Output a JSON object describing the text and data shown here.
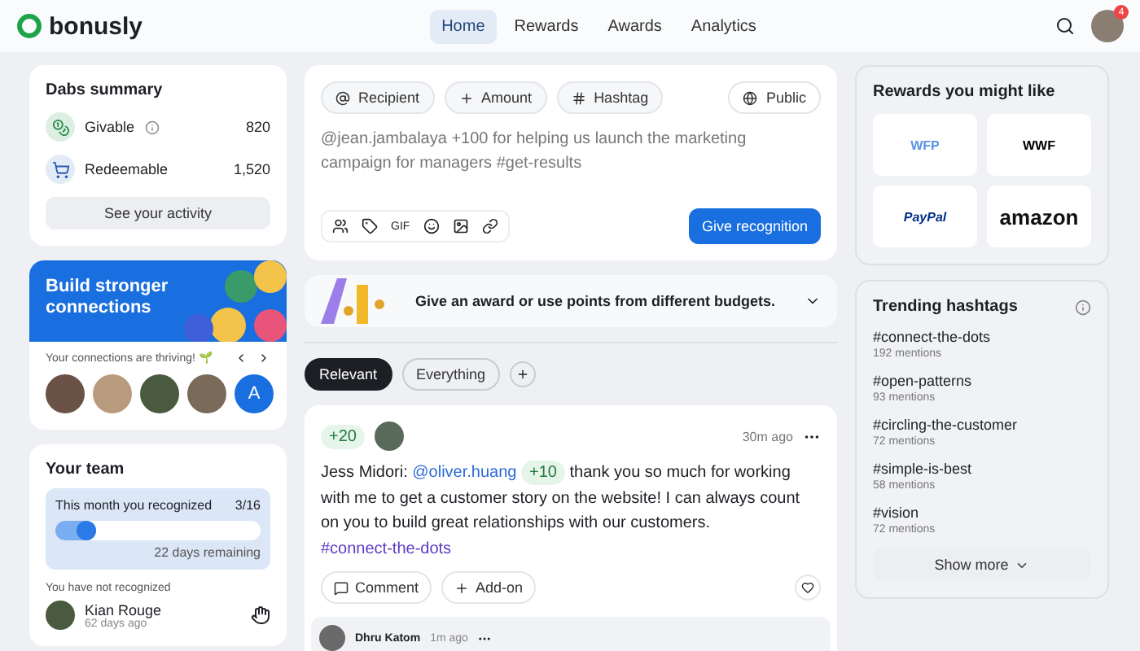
{
  "header": {
    "logo": "bonusly",
    "nav": [
      {
        "label": "Home",
        "selected": true
      },
      {
        "label": "Rewards",
        "selected": false
      },
      {
        "label": "Awards",
        "selected": false
      },
      {
        "label": "Analytics",
        "selected": false
      }
    ],
    "notifications": "4"
  },
  "dabs": {
    "title": "Dabs summary",
    "rows": [
      {
        "kind": "givable",
        "label": "Givable",
        "value": "820"
      },
      {
        "kind": "redeemable",
        "label": "Redeemable",
        "value": "1,520"
      }
    ],
    "button": "See your activity"
  },
  "connections": {
    "title": "Build stronger connections",
    "note": "Your connections are thriving! 🌱",
    "more_initial": "A"
  },
  "team": {
    "title": "Your team",
    "progress_label": "This month you recognized",
    "progress_value": "3/16",
    "level": 0.2,
    "remaining": "22 days remaining",
    "not_recognized": "You have not recognized",
    "person": {
      "name": "Kian Rouge",
      "time": "62 days ago"
    }
  },
  "composer": {
    "chips": [
      {
        "kind": "recipient",
        "label": "Recipient"
      },
      {
        "kind": "amount",
        "label": "Amount"
      },
      {
        "kind": "hashtag",
        "label": "Hashtag"
      }
    ],
    "visibility": "Public",
    "placeholder": "@jean.jambalaya +100 for helping us launch the marketing campaign for managers #get-results",
    "gif": "GIF",
    "submit": "Give recognition"
  },
  "banner": {
    "text": "Give an award or use points from different budgets."
  },
  "filters": [
    {
      "label": "Relevant",
      "selected": true
    },
    {
      "label": "Everything",
      "selected": false
    }
  ],
  "post": {
    "amount": "+20",
    "time": "30m ago",
    "author": "Jess Midori:",
    "mention": "@oliver.huang",
    "bonus": "+10",
    "body": "thank you so much for working with me to get a customer story on the website! I can always count on you to build great relationships with our customers.",
    "hashtag": "#connect-the-dots",
    "actions": [
      "Comment",
      "Add-on"
    ],
    "reply": {
      "author": "Dhru Katom",
      "time": "1m ago"
    }
  },
  "rewards": {
    "title": "Rewards you might like",
    "items": [
      {
        "kind": "wfp",
        "label": "WFP"
      },
      {
        "kind": "wwf",
        "label": "WWF"
      },
      {
        "kind": "paypal",
        "label": "PayPal"
      },
      {
        "kind": "amazon",
        "label": "amazon"
      }
    ]
  },
  "trending": {
    "title": "Trending hashtags",
    "tags": [
      {
        "tag": "#connect-the-dots",
        "count": "192 mentions"
      },
      {
        "tag": "#open-patterns",
        "count": "93 mentions"
      },
      {
        "tag": "#circling-the-customer",
        "count": "72 mentions"
      },
      {
        "tag": "#simple-is-best",
        "count": "58 mentions"
      },
      {
        "tag": "#vision",
        "count": "72 mentions"
      }
    ],
    "more": "Show more"
  }
}
